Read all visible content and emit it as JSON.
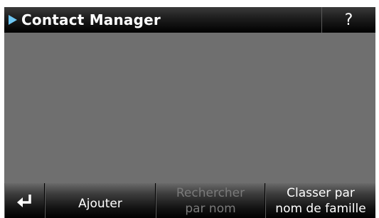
{
  "title_bar": {
    "title": "Contact Manager",
    "help_label": "?"
  },
  "bottom_bar": {
    "back_icon": "return-arrow-icon",
    "add_label": "Ajouter",
    "search_label_line1": "Rechercher",
    "search_label_line2": "par nom",
    "sort_label_line1": "Classer par",
    "sort_label_line2": "nom de famille"
  },
  "colors": {
    "title_arrow": "#6ec6f2",
    "content_background": "#6f6f6f",
    "disabled_text": "#7a7a7a"
  }
}
